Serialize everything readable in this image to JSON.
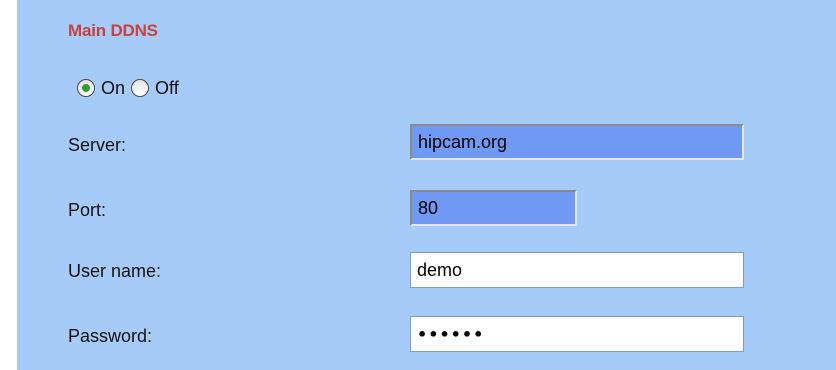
{
  "section": {
    "title": "Main DDNS"
  },
  "enable": {
    "on_label": "On",
    "off_label": "Off",
    "selected": "On"
  },
  "fields": {
    "server": {
      "label": "Server:",
      "value": "hipcam.org"
    },
    "port": {
      "label": "Port:",
      "value": "80"
    },
    "username": {
      "label": "User name:",
      "value": "demo"
    },
    "password": {
      "label": "Password:",
      "value": "••••••"
    }
  },
  "colors": {
    "panel_background": "#a6cbf9",
    "title": "#c8413c",
    "autofill_field": "#6f99f3",
    "radio_selected": "#2f9d2f"
  }
}
